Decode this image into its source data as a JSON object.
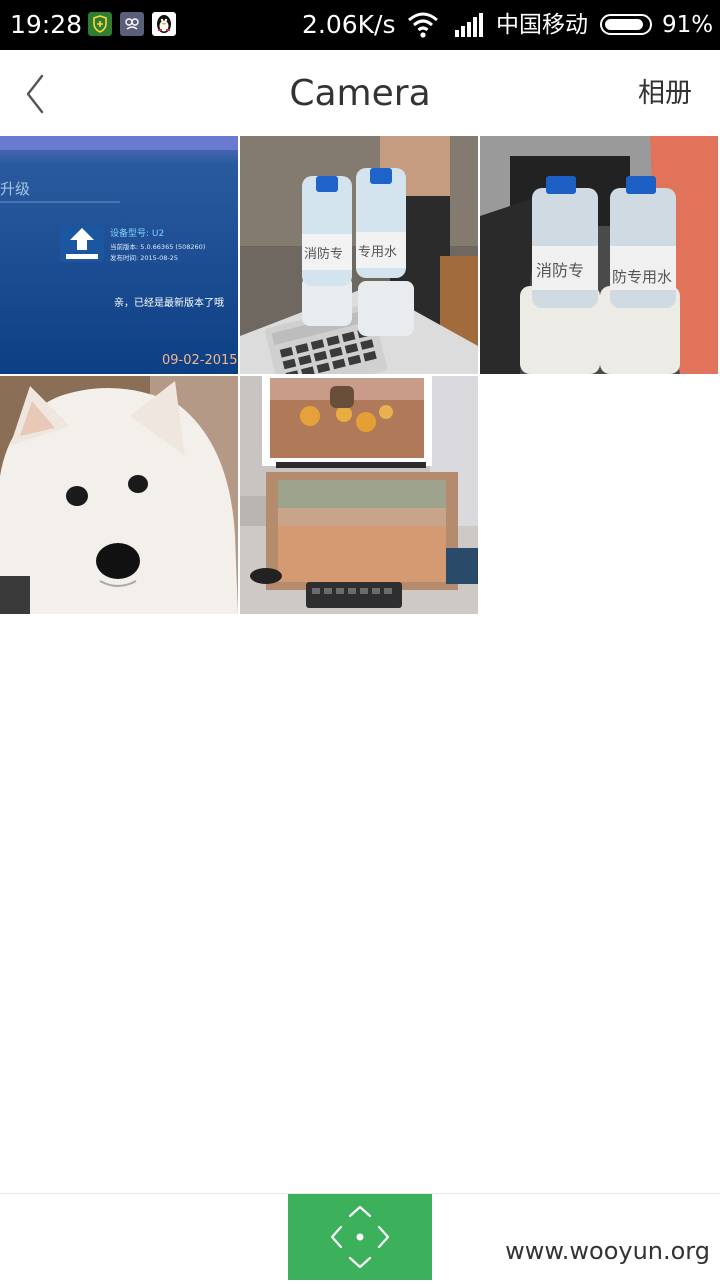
{
  "status_bar": {
    "time": "19:28",
    "net_speed": "2.06K/s",
    "carrier": "中国移动",
    "battery_percent": "91%",
    "battery_level": 0.91,
    "notification_icons": [
      "shield-icon",
      "app-icon",
      "qq-penguin-icon"
    ]
  },
  "header": {
    "title": "Camera",
    "album_label": "相册"
  },
  "photos": [
    {
      "name": "photo-upgrade-screen",
      "upgrade_label": "升级",
      "device_model_line": "设备型号: U2",
      "version_line": "当前版本: 5.0.66365 (508260)",
      "release_line": "发布时间: 2015-08-25",
      "status_line": "亲，已经是最新版本了哦",
      "timestamp": "09-02-2015"
    },
    {
      "name": "photo-water-bottles-calculator",
      "bottle_labels": [
        "消防专",
        "专用水"
      ]
    },
    {
      "name": "photo-water-bottles-closeup",
      "bottle_labels": [
        "消防专",
        "防专用水"
      ]
    },
    {
      "name": "photo-white-dog"
    },
    {
      "name": "photo-painting-easel"
    }
  ],
  "watermark": "www.wooyun.org",
  "colors": {
    "status_bar_bg": "#000000",
    "accent_green": "#3cb05a",
    "text": "#333333",
    "divider": "#e6e6e6"
  }
}
